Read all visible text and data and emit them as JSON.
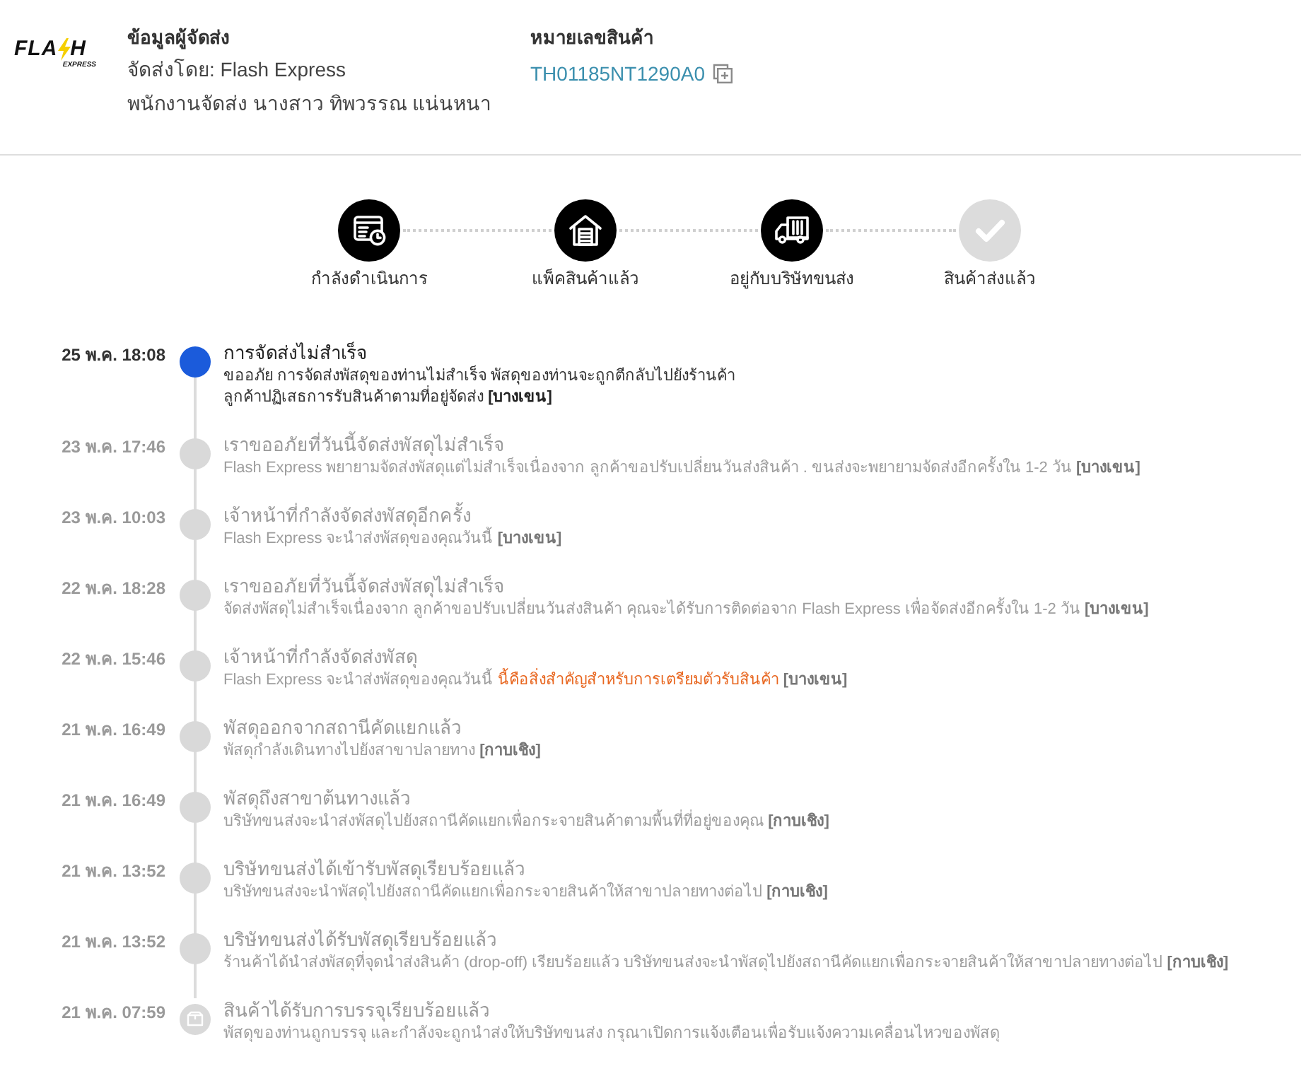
{
  "logo": {
    "letters_before_bolt": "FLA",
    "letters_after_bolt": "H",
    "tagline": "EXPRESS"
  },
  "sender": {
    "heading": "ข้อมูลผู้จัดส่ง",
    "carrier": "จัดส่งโดย: Flash Express",
    "courier": "พนักงานจัดส่ง นางสาว ทิพวรรณ แน่นหนา"
  },
  "tracking": {
    "heading": "หมายเลขสินค้า",
    "number": "TH01185NT1290A0"
  },
  "steps": [
    {
      "kind": "processing",
      "label": "กำลังดำเนินการ",
      "done": true
    },
    {
      "kind": "packed",
      "label": "แพ็คสินค้าแล้ว",
      "done": true
    },
    {
      "kind": "shipping",
      "label": "อยู่กับบริษัทขนส่ง",
      "done": true
    },
    {
      "kind": "delivered",
      "label": "สินค้าส่งแล้ว",
      "done": false
    }
  ],
  "events": [
    {
      "date": "25 พ.ค. 18:08",
      "title": "การจัดส่งไม่สำเร็จ",
      "current": true,
      "kind": "dot",
      "lines": [
        [
          {
            "kind": "text",
            "text": "ขออภัย การจัดส่งพัสดุของท่านไม่สำเร็จ พัสดุของท่านจะถูกตีกลับไปยังร้านค้า"
          }
        ],
        [
          {
            "kind": "text",
            "text": "ลูกค้าปฏิเสธการรับสินค้าตามที่อยู่จัดส่ง"
          },
          {
            "kind": "branch",
            "text": "[บางเขน]"
          }
        ]
      ]
    },
    {
      "date": "23 พ.ค. 17:46",
      "title": "เราขออภัยที่วันนี้จัดส่งพัสดุไม่สำเร็จ",
      "current": false,
      "kind": "dot",
      "lines": [
        [
          {
            "kind": "text",
            "text": "Flash Express พยายามจัดส่งพัสดุแต่ไม่สำเร็จเนื่องจาก ลูกค้าขอปรับเปลี่ยนวันส่งสินค้า . ขนส่งจะพยายามจัดส่งอีกครั้งใน 1-2 วัน"
          },
          {
            "kind": "branch",
            "text": "[บางเขน]"
          }
        ]
      ]
    },
    {
      "date": "23 พ.ค. 10:03",
      "title": "เจ้าหน้าที่กำลังจัดส่งพัสดุอีกครั้ง",
      "current": false,
      "kind": "dot",
      "lines": [
        [
          {
            "kind": "text",
            "text": "Flash Express จะนำส่งพัสดุของคุณวันนี้"
          },
          {
            "kind": "branch",
            "text": "[บางเขน]"
          }
        ]
      ]
    },
    {
      "date": "22 พ.ค. 18:28",
      "title": "เราขออภัยที่วันนี้จัดส่งพัสดุไม่สำเร็จ",
      "current": false,
      "kind": "dot",
      "lines": [
        [
          {
            "kind": "text",
            "text": "จัดส่งพัสดุไม่สำเร็จเนื่องจาก ลูกค้าขอปรับเปลี่ยนวันส่งสินค้า คุณจะได้รับการติดต่อจาก Flash Express เพื่อจัดส่งอีกครั้งใน 1-2 วัน"
          },
          {
            "kind": "branch",
            "text": "[บางเขน]"
          }
        ]
      ]
    },
    {
      "date": "22 พ.ค. 15:46",
      "title": "เจ้าหน้าที่กำลังจัดส่งพัสดุ",
      "current": false,
      "kind": "dot",
      "lines": [
        [
          {
            "kind": "text",
            "text": "Flash Express จะนำส่งพัสดุของคุณวันนี้"
          },
          {
            "kind": "notice",
            "text": "นี้คือสิ่งสำคัญสำหรับการเตรียมตัวรับสินค้า"
          },
          {
            "kind": "branch",
            "text": "[บางเขน]"
          }
        ]
      ]
    },
    {
      "date": "21 พ.ค. 16:49",
      "title": "พัสดุออกจากสถานีคัดแยกแล้ว",
      "current": false,
      "kind": "dot",
      "lines": [
        [
          {
            "kind": "text",
            "text": "พัสดุกำลังเดินทางไปยังสาขาปลายทาง"
          },
          {
            "kind": "branch",
            "text": "[กาบเชิง]"
          }
        ]
      ]
    },
    {
      "date": "21 พ.ค. 16:49",
      "title": "พัสดุถึงสาขาต้นทางแล้ว",
      "current": false,
      "kind": "dot",
      "lines": [
        [
          {
            "kind": "text",
            "text": "บริษัทขนส่งจะนำส่งพัสดุไปยังสถานีคัดแยกเพื่อกระจายสินค้าตามพื้นที่ที่อยู่ของคุณ"
          },
          {
            "kind": "branch",
            "text": "[กาบเชิง]"
          }
        ]
      ]
    },
    {
      "date": "21 พ.ค. 13:52",
      "title": "บริษัทขนส่งได้เข้ารับพัสดุเรียบร้อยแล้ว",
      "current": false,
      "kind": "dot",
      "lines": [
        [
          {
            "kind": "text",
            "text": "บริษัทขนส่งจะนำพัสดุไปยังสถานีคัดแยกเพื่อกระจายสินค้าให้สาขาปลายทางต่อไป"
          },
          {
            "kind": "branch",
            "text": "[กาบเชิง]"
          }
        ]
      ]
    },
    {
      "date": "21 พ.ค. 13:52",
      "title": "บริษัทขนส่งได้รับพัสดุเรียบร้อยแล้ว",
      "current": false,
      "kind": "dot",
      "lines": [
        [
          {
            "kind": "text",
            "text": "ร้านค้าได้นำส่งพัสดุที่จุดนำส่งสินค้า (drop-off) เรียบร้อยแล้ว บริษัทขนส่งจะนำพัสดุไปยังสถานีคัดแยกเพื่อกระจายสินค้าให้สาขาปลายทางต่อไป"
          },
          {
            "kind": "branch",
            "text": "[กาบเชิง]"
          }
        ]
      ]
    },
    {
      "date": "21 พ.ค. 07:59",
      "title": "สินค้าได้รับการบรรจุเรียบร้อยแล้ว",
      "current": false,
      "kind": "packed",
      "lines": [
        [
          {
            "kind": "text",
            "text": "พัสดุของท่านถูกบรรจุ และกำลังจะถูกนำส่งให้บริษัทขนส่ง กรุณาเปิดการแจ้งเตือนเพื่อรับแจ้งความเคลื่อนไหวของพัสดุ"
          }
        ]
      ]
    }
  ]
}
